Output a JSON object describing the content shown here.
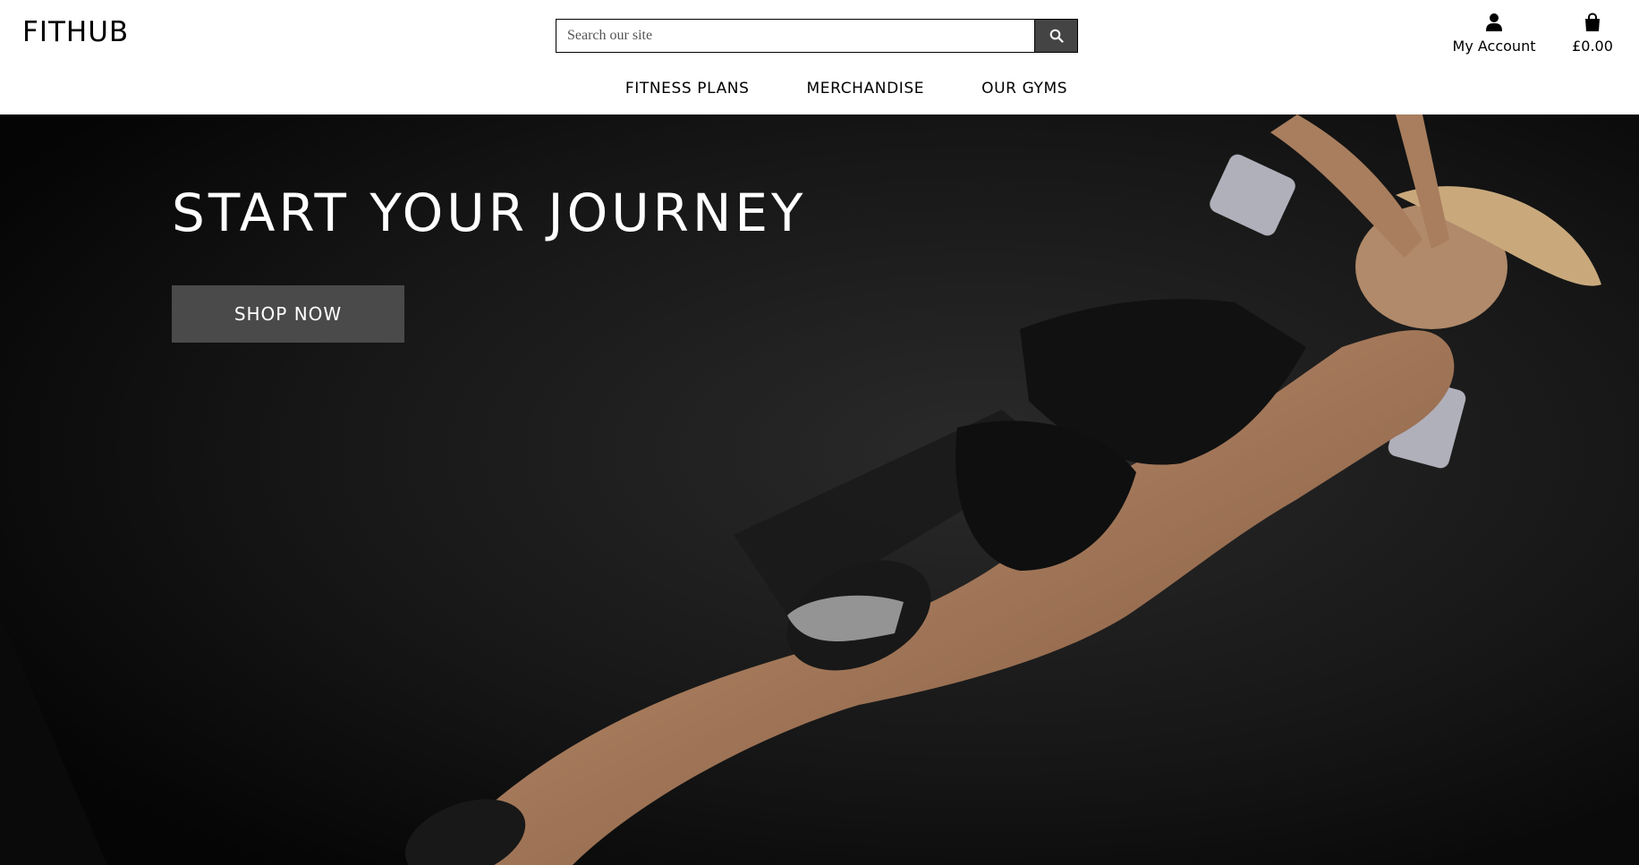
{
  "header": {
    "logo": "FITHUB",
    "search": {
      "placeholder": "Search our site"
    },
    "account_label": "My Account",
    "cart_total": "£0.00"
  },
  "nav": {
    "items": [
      {
        "label": "FITNESS PLANS"
      },
      {
        "label": "MERCHANDISE"
      },
      {
        "label": "OUR GYMS"
      }
    ]
  },
  "hero": {
    "title": "START YOUR JOURNEY",
    "button_label": "SHOP NOW"
  },
  "icons": {
    "search": "search-icon",
    "account": "user-icon",
    "cart": "shopping-bag-icon"
  },
  "colors": {
    "hero_bg": "#131313",
    "button_bg": "#4a4a4a",
    "search_button_bg": "#444444"
  }
}
